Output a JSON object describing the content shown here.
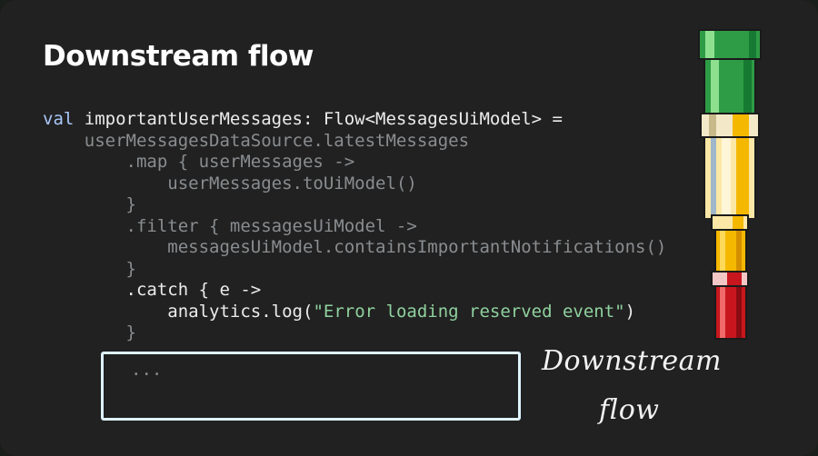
{
  "slide": {
    "title": "Downstream flow",
    "annotation_line1": "Downstream",
    "annotation_line2": "flow",
    "ellipsis": "..."
  },
  "code": {
    "line1": {
      "keyword": "val",
      "rest": " importantUserMessages: Flow<MessagesUiModel> ="
    },
    "line2": "userMessagesDataSource.latestMessages",
    "line3": ".map { userMessages ->",
    "line4": "userMessages.toUiModel()",
    "line5": "}",
    "line6": ".filter { messagesUiModel ->",
    "line7": "messagesUiModel.containsImportantNotifications()",
    "line8": "}",
    "line9": ".catch { e ->",
    "line10": {
      "call": "analytics.log(",
      "string": "\"Error loading reserved event\"",
      "close": ")"
    },
    "line11": "}"
  },
  "colors": {
    "background": "#212121",
    "keyword": "#a8c7fa",
    "dimmed_code": "#8a8d90",
    "string": "#8fd19e",
    "box_border": "#dff2ff",
    "pipe_green": "#2e9c46",
    "pipe_yellow": "#f5b800",
    "pipe_red": "#c8161e"
  },
  "illustration": {
    "icon": "pipe-icon"
  }
}
